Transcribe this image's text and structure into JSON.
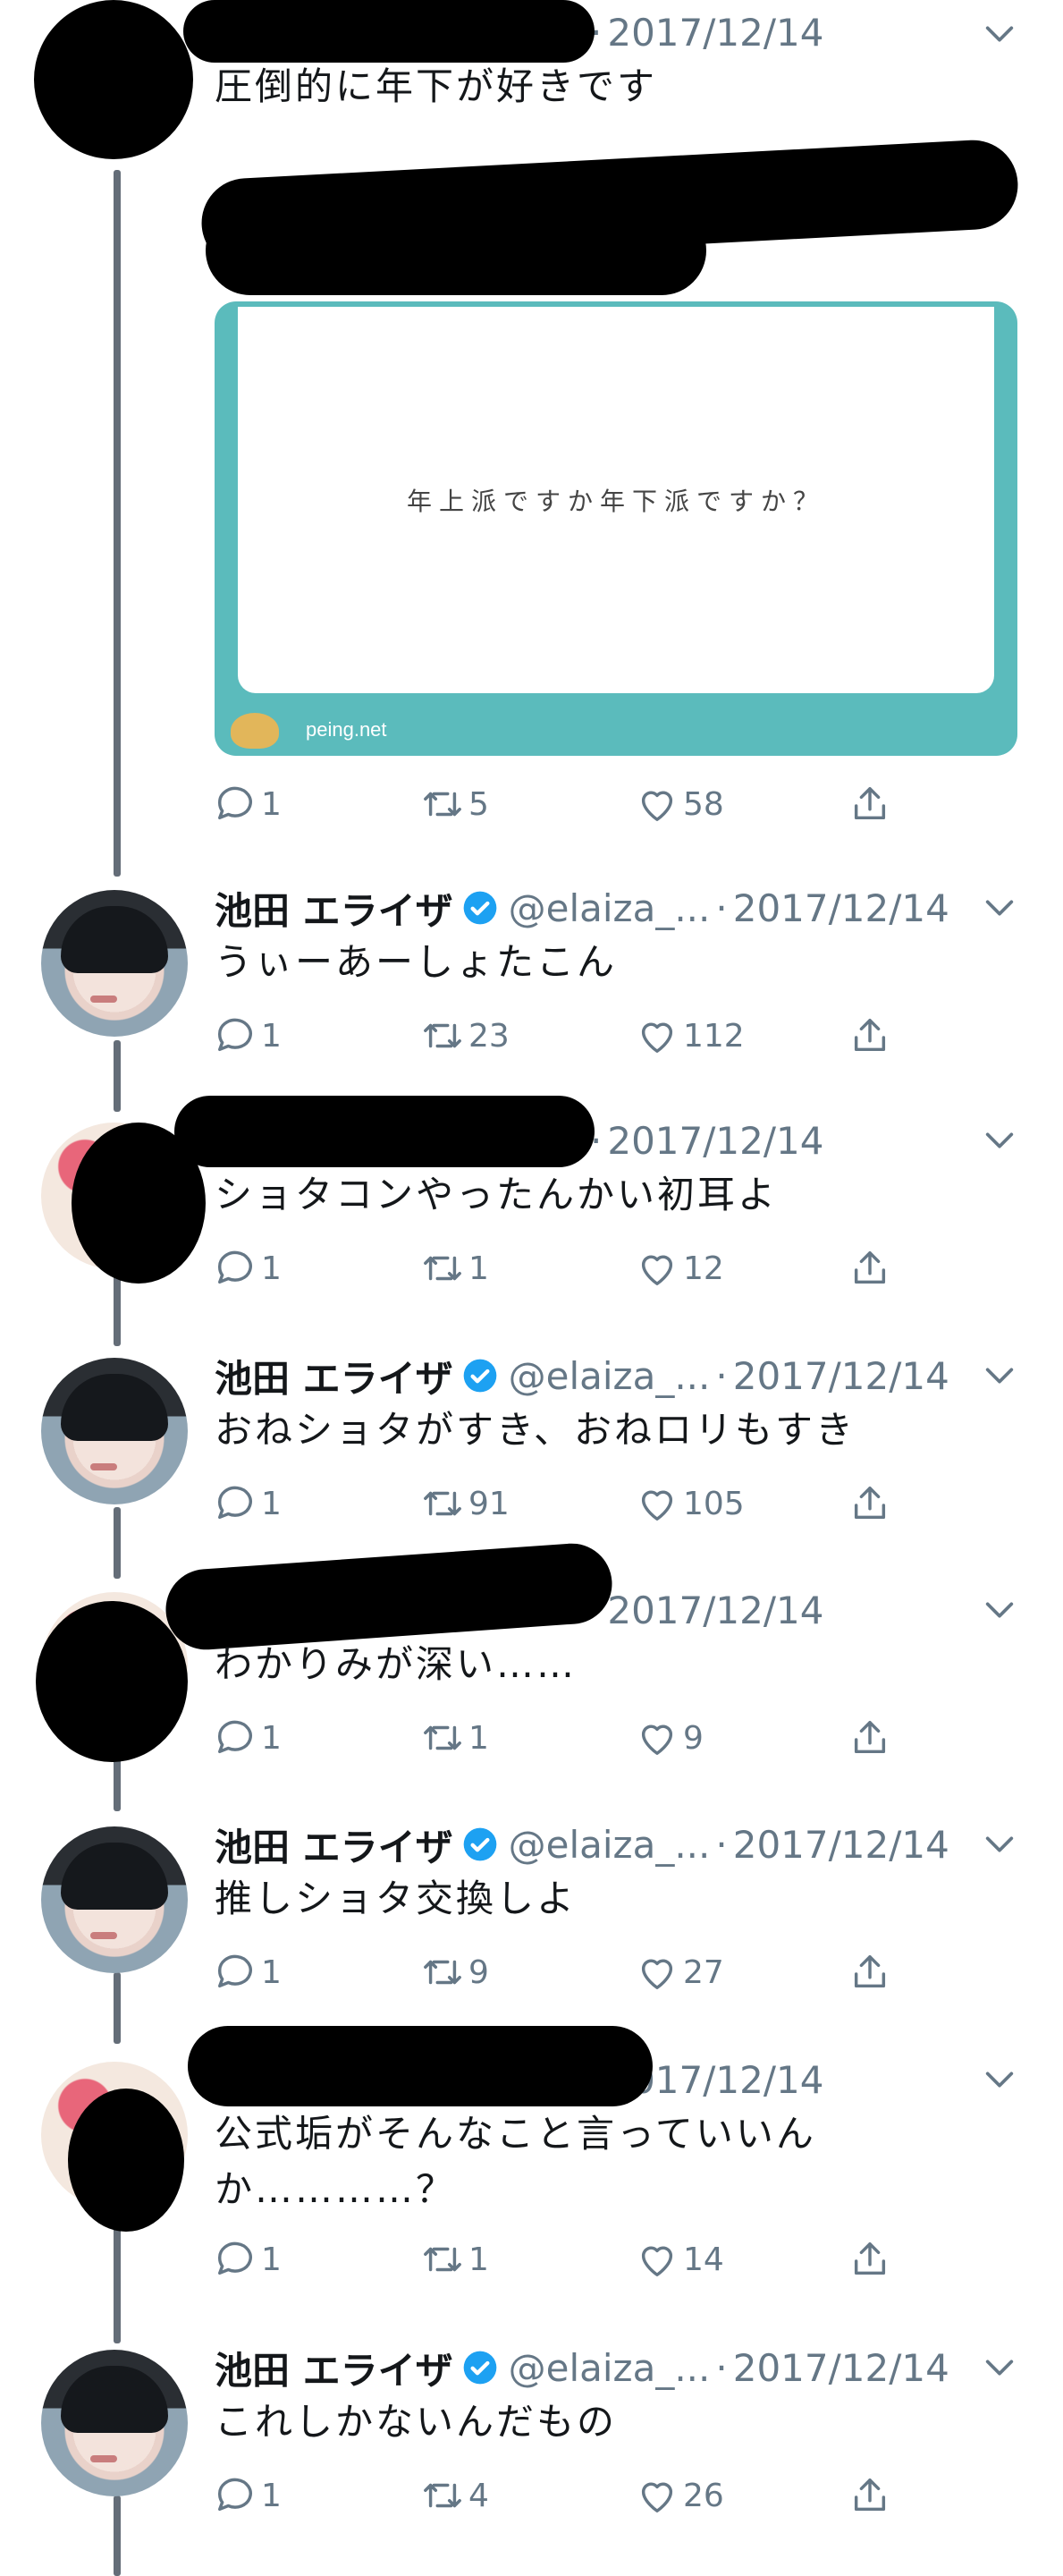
{
  "tweets": [
    {
      "kind": "other",
      "date": "2017/12/14",
      "text": "圧倒的に年下が好きです",
      "card": {
        "question": "年上派ですか年下派ですか？",
        "site": "peing.net"
      },
      "replies": "1",
      "retweets": "5",
      "likes": "58"
    },
    {
      "kind": "elaiza",
      "name": "池田 エライザ",
      "handle": "@elaiza_...",
      "date": "2017/12/14",
      "text": "うぃーあーしょたこん",
      "replies": "1",
      "retweets": "23",
      "likes": "112"
    },
    {
      "kind": "other",
      "date": "2017/12/14",
      "text": "ショタコンやったんかい初耳よ",
      "replies": "1",
      "retweets": "1",
      "likes": "12"
    },
    {
      "kind": "elaiza",
      "name": "池田 エライザ",
      "handle": "@elaiza_...",
      "date": "2017/12/14",
      "text": "おねショタがすき、おねロリもすき",
      "replies": "1",
      "retweets": "91",
      "likes": "105"
    },
    {
      "kind": "other",
      "date": "2017/12/14",
      "text": "わかりみが深い……",
      "replies": "1",
      "retweets": "1",
      "likes": "9"
    },
    {
      "kind": "elaiza",
      "name": "池田 エライザ",
      "handle": "@elaiza_...",
      "date": "2017/12/14",
      "text": "推しショタ交換しよ",
      "replies": "1",
      "retweets": "9",
      "likes": "27"
    },
    {
      "kind": "other",
      "date": "2017/12/14",
      "text": "公式垢がそんなこと言っていいんか…………？",
      "replies": "1",
      "retweets": "1",
      "likes": "14"
    },
    {
      "kind": "elaiza",
      "name": "池田 エライザ",
      "handle": "@elaiza_...",
      "date": "2017/12/14",
      "text": "これしかないんだもの",
      "replies": "1",
      "retweets": "4",
      "likes": "26"
    }
  ],
  "icons": {
    "reply": "reply-icon",
    "retweet": "retweet-icon",
    "like": "heart-icon",
    "share": "share-icon",
    "more": "chevron-down-icon",
    "verified": "verified-badge-icon"
  },
  "colors": {
    "accent": "#1da1f2",
    "verified": "#1da1f2",
    "muted": "#657786",
    "card": "#5bbbbc"
  }
}
